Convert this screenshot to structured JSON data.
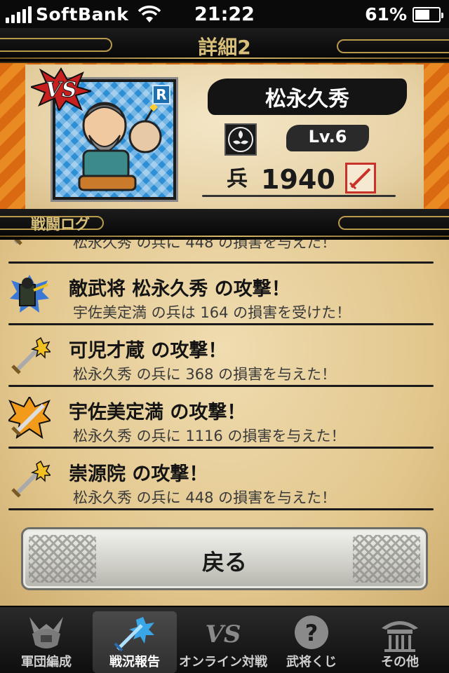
{
  "status_bar": {
    "carrier": "SoftBank",
    "time": "21:22",
    "battery": "61%",
    "battery_level": 0.61
  },
  "header": {
    "title": "詳細2"
  },
  "general": {
    "name": "松永久秀",
    "rarity": "R",
    "level": "Lv.6",
    "troops_label": "兵",
    "troops": "1940",
    "vs_label": "VS"
  },
  "log": {
    "title": "戦闘ログ",
    "entries": [
      {
        "headline": "",
        "detail": "松永久秀 の兵に 448 の損害を与えた！",
        "icon": "sword-icon"
      },
      {
        "headline": "敵武将 松永久秀 の攻撃！",
        "detail": "宇佐美定満 の兵は 164 の損害を受けた！",
        "icon": "enemy-general-icon"
      },
      {
        "headline": "可児才蔵 の攻撃！",
        "detail": "松永久秀 の兵に 368 の損害を与えた！",
        "icon": "sword-icon"
      },
      {
        "headline": "宇佐美定満 の攻撃！",
        "detail": "松永久秀 の兵に 1116 の損害を与えた！",
        "icon": "critical-sword-icon"
      },
      {
        "headline": "崇源院 の攻撃！",
        "detail": "松永久秀 の兵に 448 の損害を与えた！",
        "icon": "sword-icon"
      }
    ]
  },
  "back_button": {
    "label": "戻る"
  },
  "tabs": [
    {
      "label": "軍団編成",
      "icon": "samurai-helmet-icon",
      "active": false
    },
    {
      "label": "戦況報告",
      "icon": "sword-icon",
      "active": true
    },
    {
      "label": "オンライン対戦",
      "icon": "vs-icon",
      "active": false
    },
    {
      "label": "武将くじ",
      "icon": "question-icon",
      "active": false
    },
    {
      "label": "その他",
      "icon": "shrine-icon",
      "active": false
    }
  ],
  "colors": {
    "accent_gold": "#d8c07a",
    "card_orange": "#e98a22",
    "paper": "#e7d2a6"
  }
}
